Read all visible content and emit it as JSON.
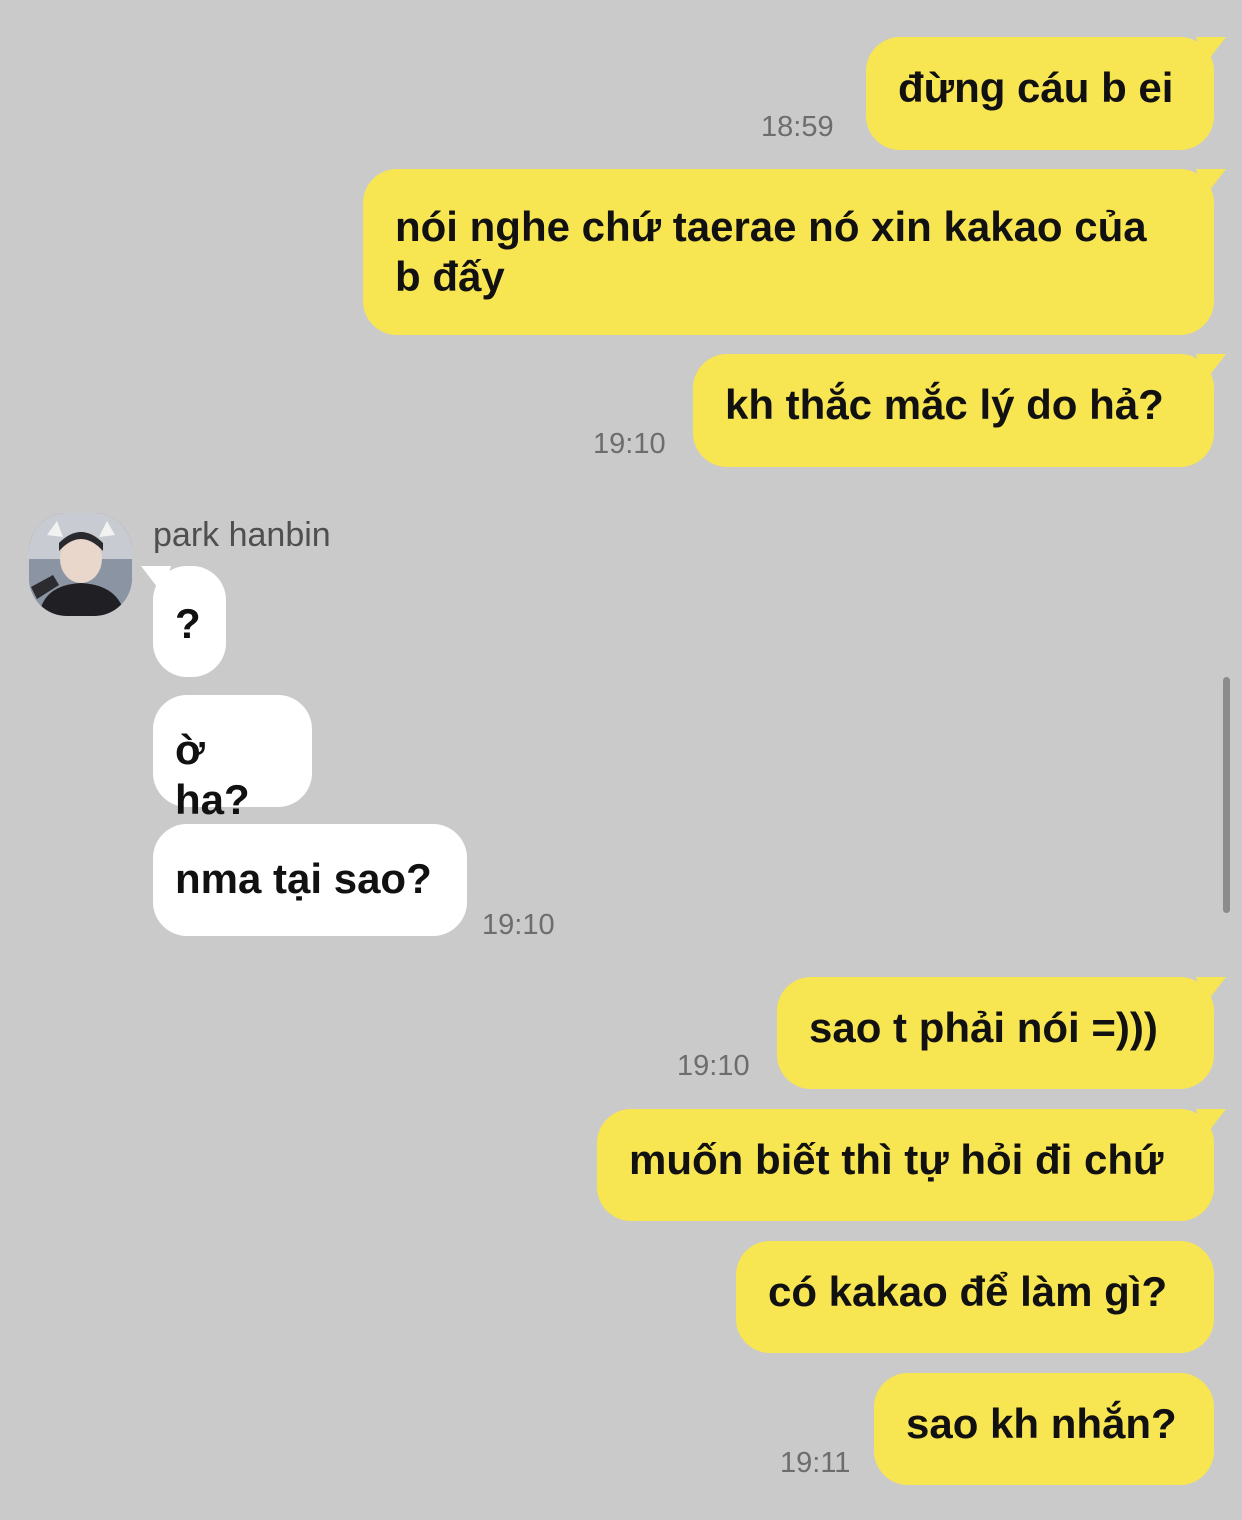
{
  "chat": {
    "contact_name": "park hanbin",
    "avatar_icon": "user-photo-avatar",
    "colors": {
      "background": "#cacaca",
      "sent_bubble": "#f8e552",
      "received_bubble": "#ffffff"
    },
    "messages": [
      {
        "from": "me",
        "text": "đừng cáu b ei",
        "time": "18:59"
      },
      {
        "from": "me",
        "text": "nói nghe chứ taerae nó xin kakao của b đấy",
        "time": ""
      },
      {
        "from": "me",
        "text": "kh thắc mắc lý do hả?",
        "time": "19:10"
      },
      {
        "from": "them",
        "text": "?",
        "time": ""
      },
      {
        "from": "them",
        "text": "ờ ha?",
        "time": ""
      },
      {
        "from": "them",
        "text": "nma tại sao?",
        "time": "19:10"
      },
      {
        "from": "me",
        "text": "sao t phải nói =)))",
        "time": "19:10"
      },
      {
        "from": "me",
        "text": "muốn biết thì tự hỏi đi chứ",
        "time": ""
      },
      {
        "from": "me",
        "text": "có kakao để làm gì?",
        "time": ""
      },
      {
        "from": "me",
        "text": "sao kh nhắn?",
        "time": "19:11"
      }
    ]
  }
}
